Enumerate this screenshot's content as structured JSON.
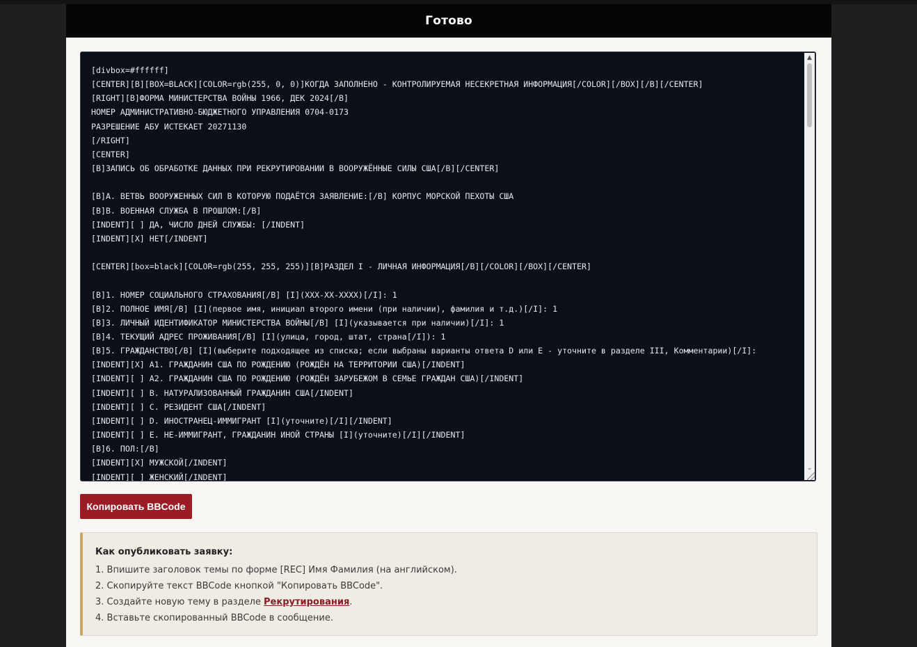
{
  "header": {
    "title": "Готово"
  },
  "bbcode": {
    "text": "[divbox=#ffffff]\n[CENTER][B][BOX=BLACK][COLOR=rgb(255, 0, 0)]КОГДА ЗАПОЛНЕНО - КОНТРОЛИРУЕМАЯ НЕСЕКРЕТНАЯ ИНФОРМАЦИЯ[/COLOR][/BOX][/B][/CENTER]\n[RIGHT][B]ФОРМА МИНИСТЕРСТВА ВОЙНЫ 1966, ДЕК 2024[/B]\nНОМЕР АДМИНИСТРАТИВНО-БЮДЖЕТНОГО УПРАВЛЕНИЯ 0704-0173\nРАЗРЕШЕНИЕ АБУ ИСТЕКАЕТ 20271130\n[/RIGHT]\n[CENTER]\n[B]ЗАПИСЬ ОБ ОБРАБОТКЕ ДАННЫХ ПРИ РЕКРУТИРОВАНИИ В ВООРУЖЁННЫЕ СИЛЫ США[/B][/CENTER]\n\n[B]А. ВЕТВЬ ВООРУЖЕННЫХ СИЛ В КОТОРУЮ ПОДАЁТСЯ ЗАЯВЛЕНИЕ:[/B] КОРПУС МОРСКОЙ ПЕХОТЫ США\n[B]В. ВОЕННАЯ СЛУЖБА В ПРОШЛОМ:[/B]\n[INDENT][ ] ДА, ЧИСЛО ДНЕЙ СЛУЖБЫ: [/INDENT]\n[INDENT][X] НЕТ[/INDENT]\n\n[CENTER][box=black][COLOR=rgb(255, 255, 255)][B]РАЗДЕЛ I - ЛИЧНАЯ ИНФОРМАЦИЯ[/B][/COLOR][/BOX][/CENTER]\n\n[B]1. НОМЕР СОЦИАЛЬНОГО СТРАХОВАНИЯ[/B] [I](XXX-XX-XXXX)[/I]: 1\n[B]2. ПОЛНОЕ ИМЯ[/B] [I](первое имя, инициал второго имени (при наличии), фамилия и т.д.)[/I]: 1\n[B]3. ЛИЧНЫЙ ИДЕНТИФИКАТОР МИНИСТЕРСТВА ВОЙНЫ[/B] [I](указывается при наличии)[/I]: 1\n[B]4. ТЕКУЩИЙ АДРЕС ПРОЖИВАНИЯ[/B] [I](улица, город, штат, страна[/I]): 1\n[B]5. ГРАЖДАНСТВО[/B] [I](выберите подходящее из списка; если выбраны варианты ответа D или E - уточните в разделе III, Комментарии)[/I]:\n[INDENT][X] A1. ГРАЖДАНИН США ПО РОЖДЕНИЮ (РОЖДЁН НА ТЕРРИТОРИИ США)[/INDENT]\n[INDENT][ ] A2. ГРАЖДАНИН США ПО РОЖДЕНИЮ (РОЖДЁН ЗАРУБЕЖОМ В СЕМЬЕ ГРАЖДАН США)[/INDENT]\n[INDENT][ ] B. НАТУРАЛИЗОВАННЫЙ ГРАЖДАНИН США[/INDENT]\n[INDENT][ ] C. РЕЗИДЕНТ США[/INDENT]\n[INDENT][ ] D. ИНОСТРАНЕЦ-ИММИГРАНТ [I](уточните)[/I][/INDENT]\n[INDENT][ ] E. НЕ-ИММИГРАНТ, ГРАЖДАНИН ИНОЙ СТРАНЫ [I](уточните)[/I][/INDENT]\n[B]6. ПОЛ:[/B]\n[INDENT][X] МУЖСКОЙ[/INDENT]\n[INDENT][ ] ЖЕНСКИЙ[/INDENT]"
  },
  "copy_button": {
    "label": "Копировать BBCode"
  },
  "instructions": {
    "title": "Как опубликовать заявку:",
    "step1": "1. Впишите заголовок темы по форме [REC] Имя Фамилия (на английском).",
    "step2": "2. Скопируйте текст BBCode кнопкой \"Копировать BBCode\".",
    "step3_prefix": "3. Создайте новую тему в разделе ",
    "step3_link": "Рекрутирования",
    "step3_suffix": ".",
    "step4": "4. Вставьте скопированный BBCode в сообщение."
  },
  "colors": {
    "header_bg": "#050505",
    "code_bg": "#0b0f17",
    "button_bg": "#9b1c25",
    "info_accent": "#c9a567",
    "link": "#8c1a22"
  },
  "icons": {
    "scroll_up": "chevron-up-icon",
    "scroll_down": "chevron-down-icon",
    "resize": "resize-grip-icon"
  }
}
